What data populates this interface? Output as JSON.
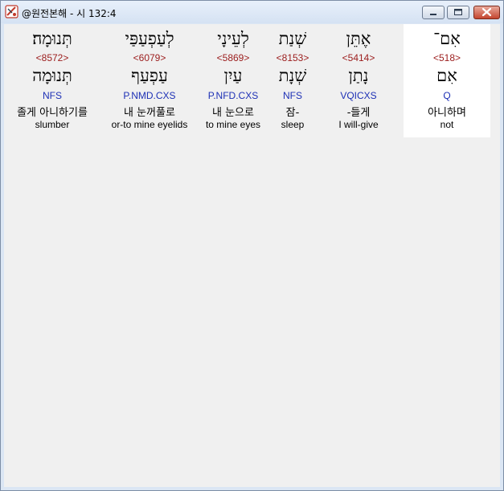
{
  "window": {
    "title": "@원전본해 - 시 132:4"
  },
  "columns": [
    {
      "hebrew": "תְּנוּמָה׃",
      "strong": "<8572>",
      "lemma": "תְּנוּמָה",
      "morph": "NFS",
      "korean": "졸게 아니하기를",
      "english": "slumber",
      "selected": false
    },
    {
      "hebrew": "לְעַפְעַפַּי",
      "strong": "<6079>",
      "lemma": "עַפְעַף",
      "morph": "P.NMD.CXS",
      "korean": "내 눈꺼풀로",
      "english": "or-to mine eyelids",
      "selected": false
    },
    {
      "hebrew": "לְעֵינָי",
      "strong": "<5869>",
      "lemma": "עַיִן",
      "morph": "P.NFD.CXS",
      "korean": "내 눈으로",
      "english": "to mine eyes",
      "selected": false
    },
    {
      "hebrew": "שְׁנַת",
      "strong": "<8153>",
      "lemma": "שְׁנָת",
      "morph": "NFS",
      "korean": "잠-",
      "english": "sleep",
      "selected": false
    },
    {
      "hebrew": "אֶתֵּן",
      "strong": "<5414>",
      "lemma": "נָתַן",
      "morph": "VQICXS",
      "korean": "-들게",
      "english": "I will-give",
      "selected": false
    },
    {
      "hebrew": "אִם־",
      "strong": "<518>",
      "lemma": "אִם",
      "morph": "Q",
      "korean": "아니하며",
      "english": "not",
      "selected": true
    }
  ]
}
